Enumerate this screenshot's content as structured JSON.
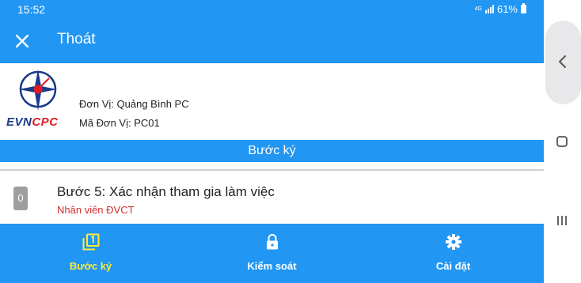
{
  "status_bar": {
    "time": "15:52",
    "network": "4G",
    "battery": "61%"
  },
  "app_bar": {
    "close_icon": "close-icon",
    "title": "Thoát"
  },
  "header": {
    "logo": {
      "brand_evn": "EVN",
      "brand_cpc": "CPC"
    },
    "unit_name": "Đơn Vị: Quảng Bình PC",
    "unit_code": "Mã Đơn Vị: PC01"
  },
  "section": {
    "title": "Bước ký"
  },
  "steps": [
    {
      "badge": "0",
      "title": "Bước 5: Xác nhận tham gia làm việc",
      "subtitle": "Nhân viên ĐVCT"
    }
  ],
  "bottom_nav": {
    "items": [
      {
        "label": "Bước ký",
        "icon": "filter-1-icon",
        "active": true
      },
      {
        "label": "Kiểm soát",
        "icon": "lock-icon",
        "active": false
      },
      {
        "label": "Cài đặt",
        "icon": "gear-icon",
        "active": false
      }
    ]
  },
  "colors": {
    "primary": "#2196f3",
    "active_nav": "#ffeb3b",
    "subtitle": "#d32f2f",
    "badge": "#9e9e9e"
  },
  "android_nav": {
    "buttons": [
      "back-icon",
      "home-icon",
      "recents-icon"
    ]
  }
}
